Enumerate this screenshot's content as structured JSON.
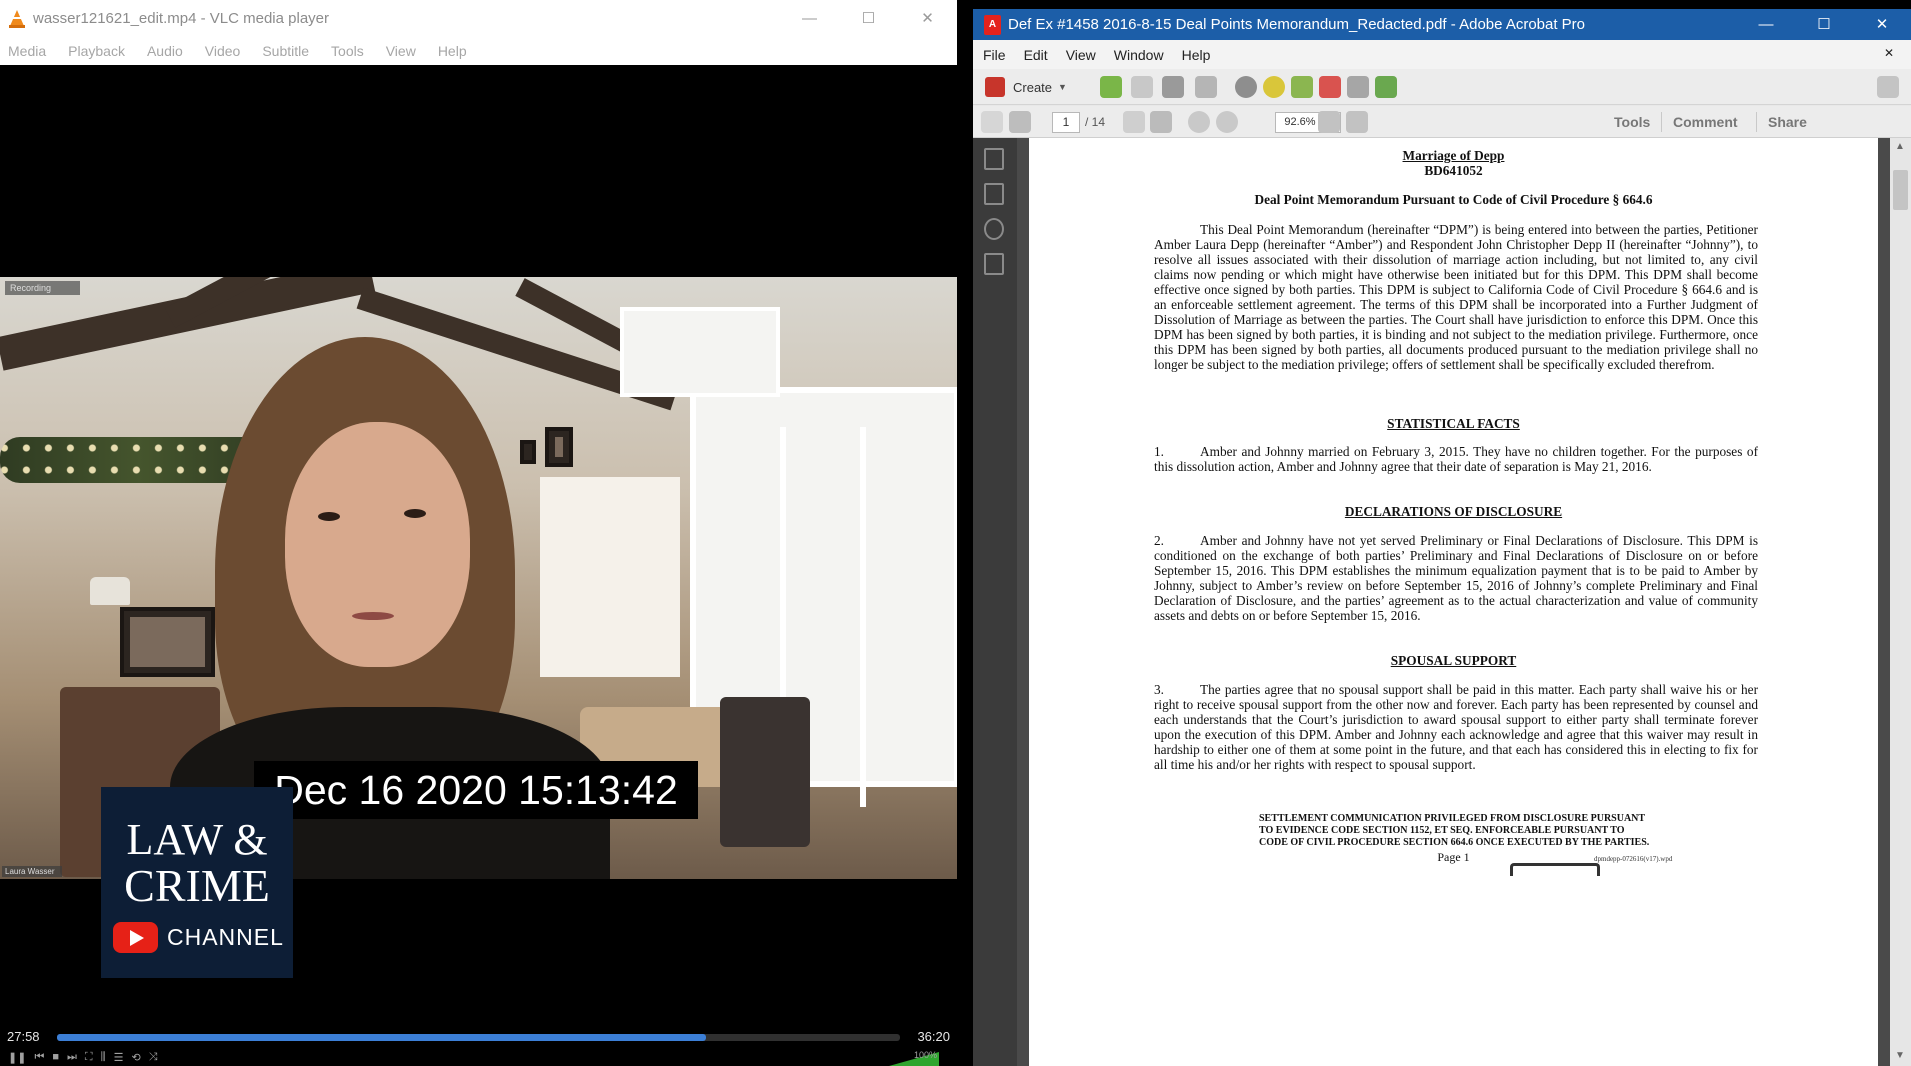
{
  "vlc": {
    "title": "wasser121621_edit.mp4 - VLC media player",
    "menu": [
      "Media",
      "Playback",
      "Audio",
      "Video",
      "Subtitle",
      "Tools",
      "View",
      "Help"
    ],
    "window_controls": [
      "—",
      "☐",
      "✕"
    ],
    "video": {
      "timestamp": "Dec 16 2020 15:13:42",
      "recording_tag": "Recording",
      "name_tag": "Laura Wasser",
      "watermark": {
        "line1": "LAW & ",
        "line2": "CRIME",
        "line3": "CHANNEL",
        "icon": "youtube-play-icon"
      }
    },
    "seek": {
      "elapsed": "27:58",
      "total": "36:20",
      "progress": 0.77,
      "color": "#3c7fd6"
    },
    "controls": [
      "pause-icon",
      "prev-icon",
      "stop-icon",
      "next-icon",
      "fullscreen-icon",
      "extended-icon",
      "playlist-icon",
      "loop-icon",
      "shuffle-icon"
    ],
    "volume": "100%"
  },
  "acrobat": {
    "title": "Def Ex  #1458 2016-8-15 Deal Points Memorandum_Redacted.pdf - Adobe Acrobat Pro",
    "titlebar_color": "#1c5ea8",
    "window_controls": [
      "—",
      "☐",
      "✕"
    ],
    "menu": [
      "File",
      "Edit",
      "View",
      "Window",
      "Help"
    ],
    "close_doc": "✕",
    "toolbar": {
      "create_label": "Create",
      "page_current": "1",
      "page_total": "/ 14",
      "zoom": "92.6%",
      "tabs": [
        "Tools",
        "Comment",
        "Share"
      ]
    },
    "document": {
      "heading1": "Marriage of Depp",
      "heading2": "BD641052",
      "title": "Deal Point Memorandum Pursuant to Code of Civil Procedure § 664.6",
      "intro": "This Deal Point Memorandum (hereinafter “DPM”) is being entered into between the parties, Petitioner Amber Laura Depp (hereinafter “Amber”) and Respondent John Christopher Depp II (hereinafter “Johnny”), to resolve all issues associated with their dissolution of marriage action including, but not limited to, any civil claims now pending or which might have otherwise been initiated but for this DPM.  This DPM shall become effective once signed by both parties.  This DPM is subject to California Code of Civil Procedure § 664.6 and is an enforceable settlement agreement.  The terms of this DPM shall be incorporated into a Further Judgment of Dissolution of Marriage as between the parties.  The Court shall have jurisdiction to enforce this DPM.  Once this DPM has been signed by both parties, it is binding and not subject to the mediation privilege.  Furthermore, once this DPM has been signed by both parties, all documents produced pursuant to the mediation privilege shall no longer be subject to the mediation privilege; offers of settlement shall be specifically excluded therefrom.",
      "sections": [
        {
          "heading": "STATISTICAL FACTS",
          "num": "1.",
          "text": "Amber and Johnny married on February 3, 2015.  They have no children together.  For the purposes of this dissolution action, Amber and Johnny agree that their date of separation is May 21, 2016."
        },
        {
          "heading": "DECLARATIONS OF DISCLOSURE",
          "num": "2.",
          "text": "Amber and Johnny have not yet served Preliminary or Final Declarations of Disclosure. This DPM is conditioned on the exchange of both parties’ Preliminary and Final Declarations of Disclosure on or before September 15, 2016.  This DPM establishes the minimum equalization payment that is to be paid to Amber by Johnny, subject to Amber’s review on before September 15, 2016 of Johnny’s complete Preliminary and Final Declaration of Disclosure, and the parties’ agreement as to the actual characterization and value of community assets and debts on or before September 15, 2016."
        },
        {
          "heading": "SPOUSAL SUPPORT",
          "num": "3.",
          "text": "The parties agree that no spousal support shall be paid in this matter.  Each party shall waive his or her right to receive spousal support from the other now and forever.  Each party has been represented by counsel and each understands that the Court’s jurisdiction to award spousal support to either party shall terminate forever upon the execution of this DPM.  Amber and Johnny each acknowledge and agree that this waiver may result in hardship to either one of them at some point in the future, and that each has considered this in electing to fix for all time his and/or her rights with respect to spousal support."
        }
      ],
      "footer_line1": "SETTLEMENT COMMUNICATION PRIVILEGED FROM DISCLOSURE PURSUANT",
      "footer_line2": "TO EVIDENCE CODE SECTION 1152, ET SEQ.  ENFORCEABLE PURSUANT TO",
      "footer_line3": "CODE OF CIVIL PROCEDURE SECTION 664.6 ONCE EXECUTED BY THE PARTIES.",
      "page_label": "Page 1",
      "file_ref": "dpmdepp-072616(v17).wpd"
    }
  }
}
